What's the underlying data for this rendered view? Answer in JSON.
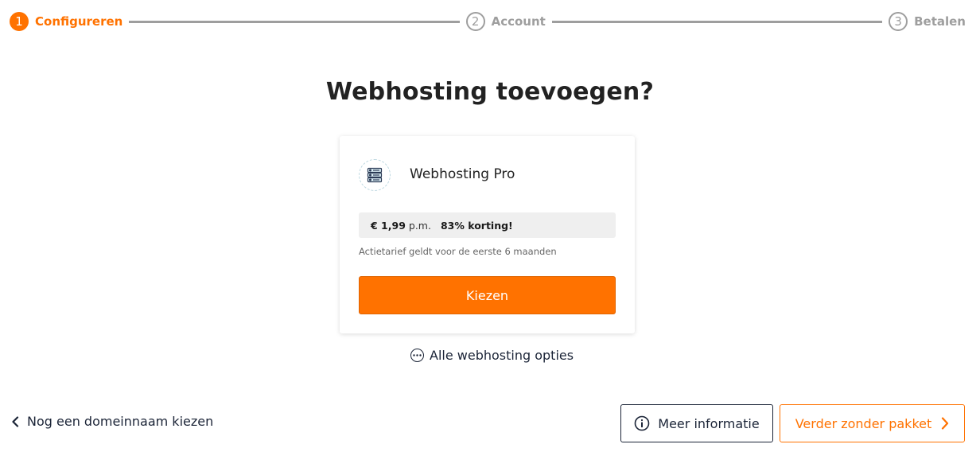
{
  "stepper": {
    "steps": [
      {
        "number": "1",
        "label": "Configureren",
        "state": "active"
      },
      {
        "number": "2",
        "label": "Account",
        "state": "inactive"
      },
      {
        "number": "3",
        "label": "Betalen",
        "state": "inactive"
      }
    ]
  },
  "heading": "Webhosting toevoegen?",
  "card": {
    "icon": "server-stack-icon",
    "product_name": "Webhosting Pro",
    "price": "€ 1,99",
    "price_period": "p.m.",
    "discount": "83% korting!",
    "promo_note": "Actietarief geldt voor de eerste 6 maanden",
    "choose_label": "Kiezen"
  },
  "all_options": {
    "icon": "ellipsis-circle-icon",
    "label": "Alle webhosting opties"
  },
  "footer": {
    "back_label": "Nog een domeinnaam kiezen",
    "more_info_label": "Meer informatie",
    "continue_label": "Verder zonder pakket"
  },
  "colors": {
    "accent": "#ff7200",
    "dark_text": "#1b2437",
    "inactive": "#9e9e9e"
  }
}
